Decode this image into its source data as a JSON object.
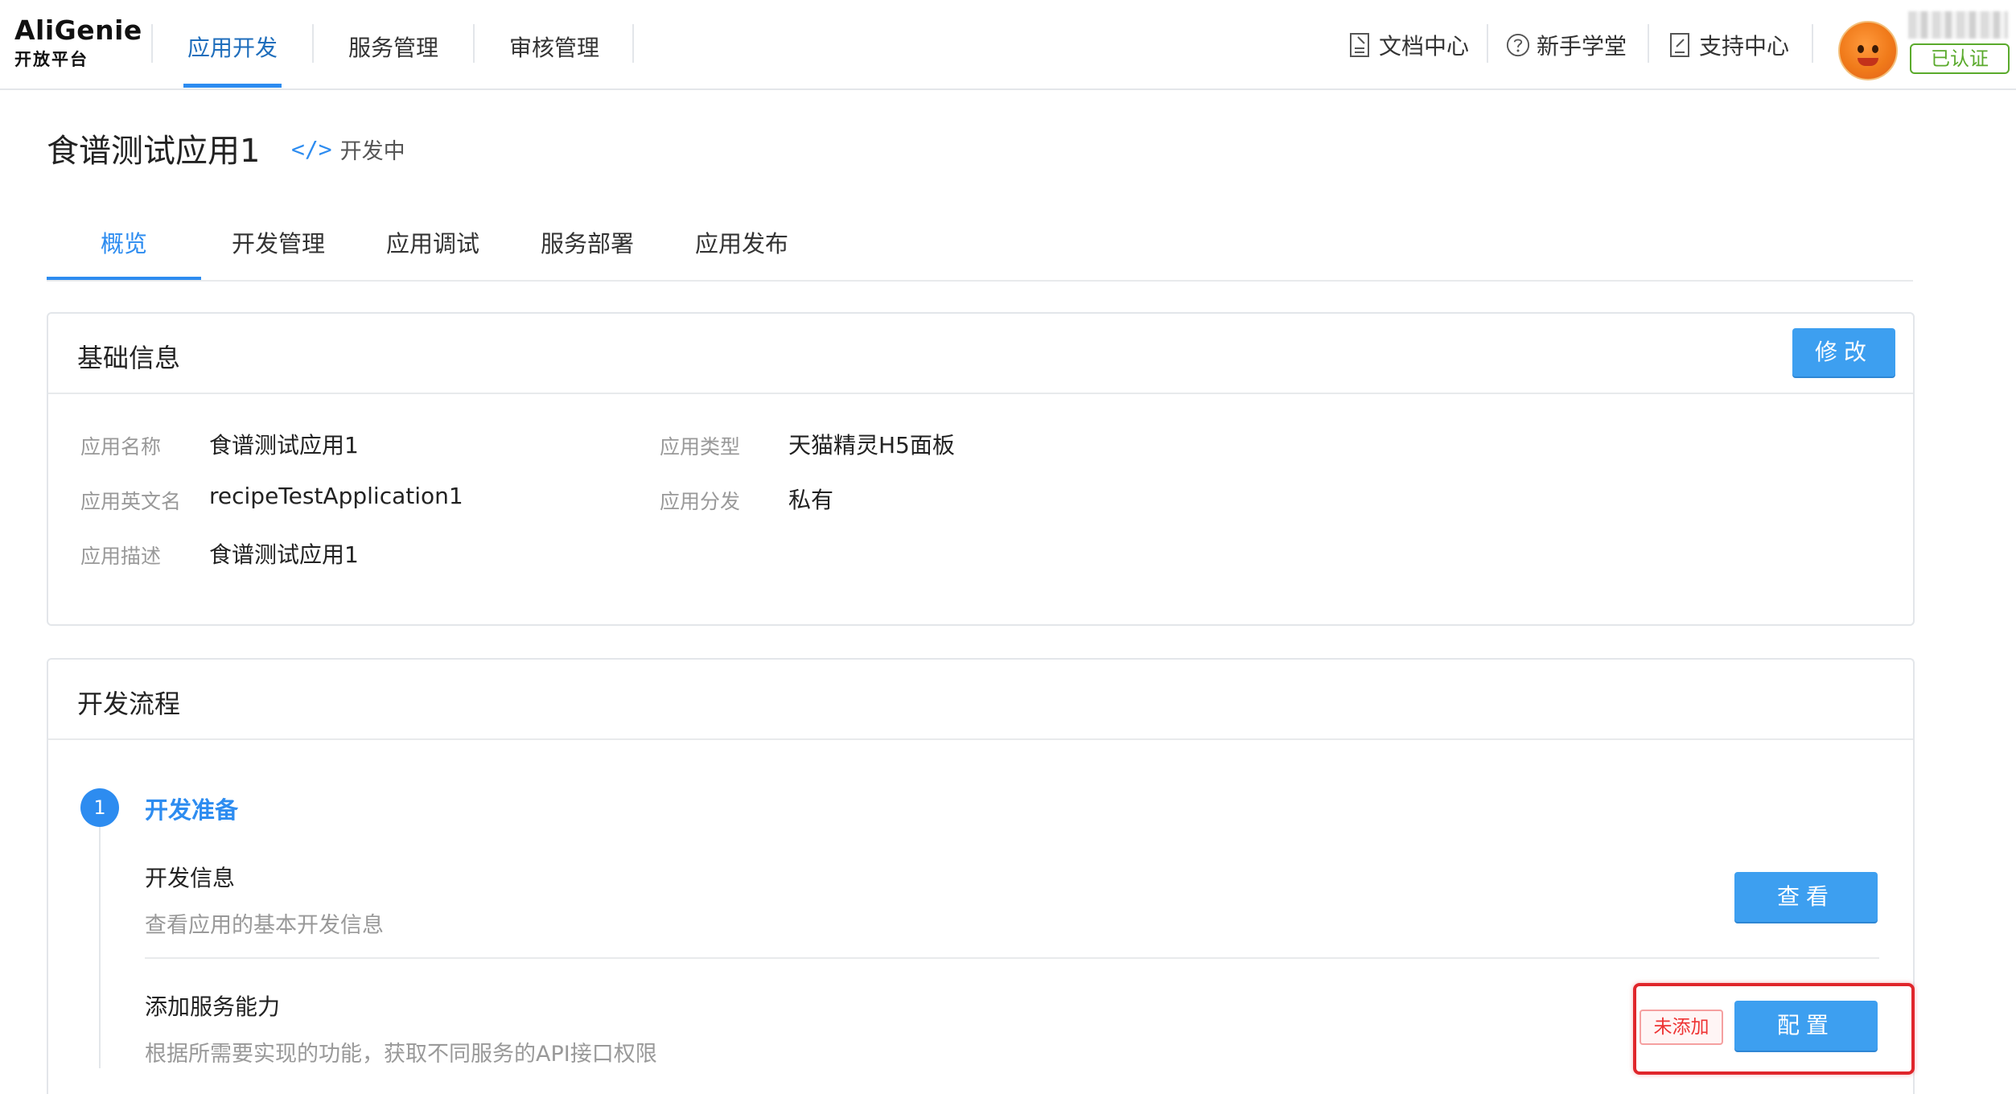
{
  "topnav": {
    "logo_en": "AliGenie",
    "logo_cn": "开放平台",
    "items": [
      {
        "label": "应用开发",
        "active": true
      },
      {
        "label": "服务管理",
        "active": false
      },
      {
        "label": "审核管理",
        "active": false
      }
    ],
    "utils": [
      {
        "label": "文档中心",
        "icon": "document-icon"
      },
      {
        "label": "新手学堂",
        "icon": "help-circle-icon"
      },
      {
        "label": "支持中心",
        "icon": "edit-doc-icon"
      }
    ],
    "cert_badge": "已认证"
  },
  "app": {
    "title": "食谱测试应用1",
    "status_icon": "</>",
    "status": "开发中"
  },
  "tabs": [
    {
      "label": "概览",
      "active": true
    },
    {
      "label": "开发管理",
      "active": false
    },
    {
      "label": "应用调试",
      "active": false
    },
    {
      "label": "服务部署",
      "active": false
    },
    {
      "label": "应用发布",
      "active": false
    }
  ],
  "basic_info": {
    "title": "基础信息",
    "edit_button": "修改",
    "fields": [
      {
        "label": "应用名称",
        "value": "食谱测试应用1"
      },
      {
        "label": "应用类型",
        "value": "天猫精灵H5面板"
      },
      {
        "label": "应用英文名",
        "value": "recipeTestApplication1"
      },
      {
        "label": "应用分发",
        "value": "私有"
      },
      {
        "label": "应用描述",
        "value": "食谱测试应用1"
      }
    ]
  },
  "dev_flow": {
    "title": "开发流程",
    "step": {
      "number": "1",
      "title": "开发准备"
    },
    "items": [
      {
        "title": "开发信息",
        "desc": "查看应用的基本开发信息",
        "button": "查看"
      },
      {
        "title": "添加服务能力",
        "desc": "根据所需要实现的功能，获取不同服务的API接口权限",
        "button": "配置",
        "tag": "未添加"
      }
    ]
  },
  "colors": {
    "accent": "#2d8cf0",
    "button": "#3d9ff0",
    "verified": "#5aaa2c",
    "warning_tag": "#ee3333",
    "highlight": "#e0262b"
  }
}
